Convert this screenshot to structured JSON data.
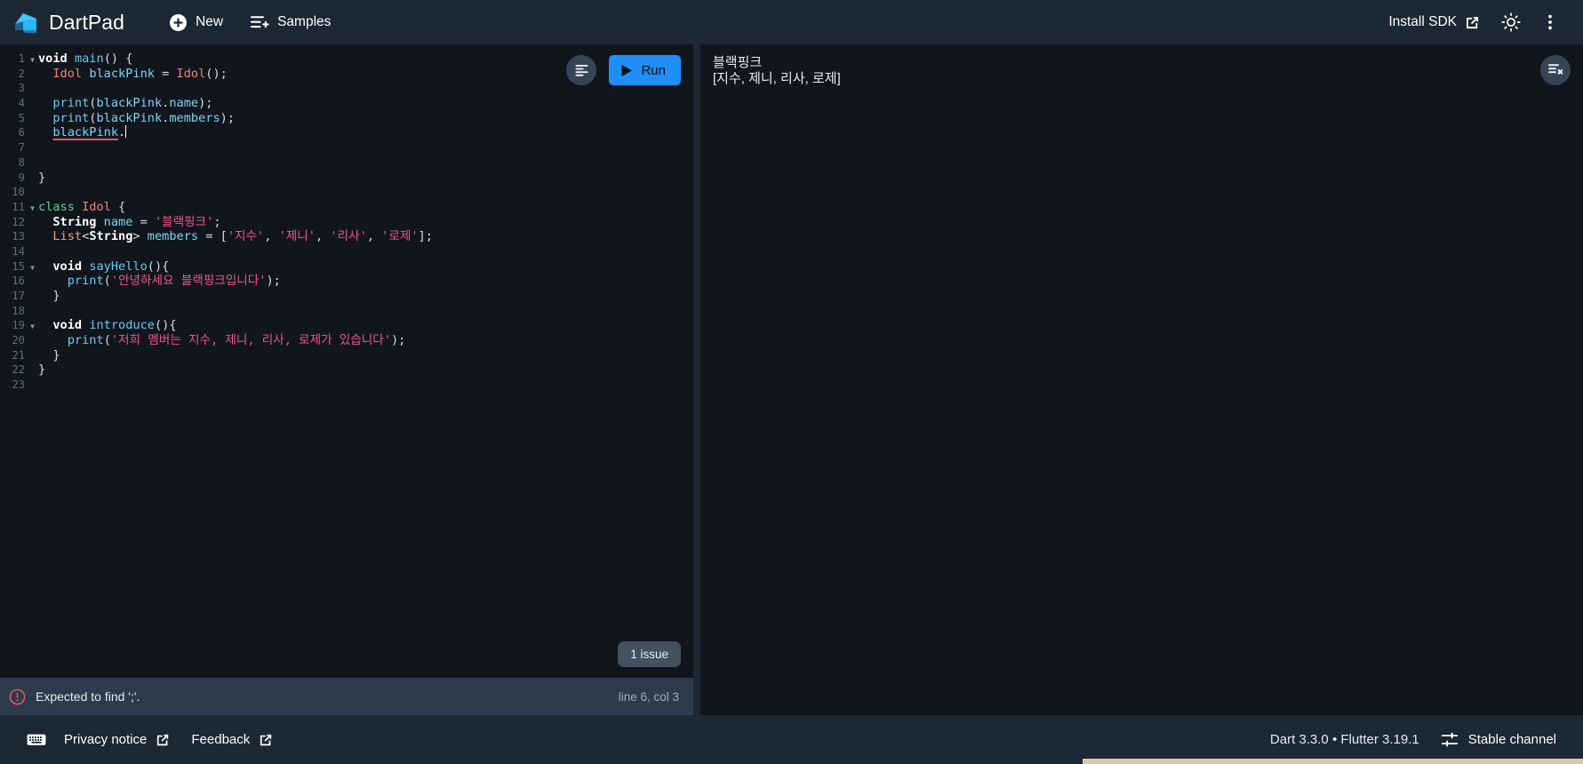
{
  "app": {
    "name": "DartPad"
  },
  "header": {
    "logo_icon": "dart-logo-icon",
    "new_label": "New",
    "new_icon": "plus-circle-icon",
    "samples_label": "Samples",
    "samples_icon": "list-add-icon",
    "install_sdk_label": "Install SDK",
    "install_sdk_icon": "external-link-icon",
    "theme_icon": "brightness-sun-icon",
    "overflow_icon": "more-vert-icon"
  },
  "editor": {
    "format_icon": "format-align-icon",
    "run_label": "Run",
    "run_icon": "play-triangle-icon",
    "issue_pill_label": "1 issue",
    "cursor_line": 6,
    "lines": [
      {
        "n": "1",
        "fold": true,
        "tokens": [
          {
            "t": "void",
            "c": "kwb"
          },
          {
            "t": " ",
            "c": "punct"
          },
          {
            "t": "main",
            "c": "fn"
          },
          {
            "t": "() {",
            "c": "punct"
          }
        ]
      },
      {
        "n": "2",
        "fold": false,
        "tokens": [
          {
            "t": "  ",
            "c": "punct"
          },
          {
            "t": "Idol",
            "c": "typ"
          },
          {
            "t": " ",
            "c": "punct"
          },
          {
            "t": "blackPink",
            "c": "prop"
          },
          {
            "t": " = ",
            "c": "punct"
          },
          {
            "t": "Idol",
            "c": "typ"
          },
          {
            "t": "();",
            "c": "punct"
          }
        ]
      },
      {
        "n": "3",
        "fold": false,
        "tokens": []
      },
      {
        "n": "4",
        "fold": false,
        "tokens": [
          {
            "t": "  ",
            "c": "punct"
          },
          {
            "t": "print",
            "c": "fn"
          },
          {
            "t": "(",
            "c": "punct"
          },
          {
            "t": "blackPink",
            "c": "prop"
          },
          {
            "t": ".",
            "c": "punct"
          },
          {
            "t": "name",
            "c": "prop"
          },
          {
            "t": ");",
            "c": "punct"
          }
        ]
      },
      {
        "n": "5",
        "fold": false,
        "tokens": [
          {
            "t": "  ",
            "c": "punct"
          },
          {
            "t": "print",
            "c": "fn"
          },
          {
            "t": "(",
            "c": "punct"
          },
          {
            "t": "blackPink",
            "c": "prop"
          },
          {
            "t": ".",
            "c": "punct"
          },
          {
            "t": "members",
            "c": "prop"
          },
          {
            "t": ");",
            "c": "punct"
          }
        ]
      },
      {
        "n": "6",
        "fold": false,
        "tokens": [
          {
            "t": "  ",
            "c": "punct"
          },
          {
            "t": "blackPink",
            "c": "prop err-underline"
          },
          {
            "t": ".",
            "c": "punct"
          }
        ],
        "caret": true
      },
      {
        "n": "7",
        "fold": false,
        "tokens": []
      },
      {
        "n": "8",
        "fold": false,
        "tokens": []
      },
      {
        "n": "9",
        "fold": false,
        "tokens": [
          {
            "t": "}",
            "c": "punct"
          }
        ]
      },
      {
        "n": "10",
        "fold": false,
        "tokens": []
      },
      {
        "n": "11",
        "fold": true,
        "tokens": [
          {
            "t": "class",
            "c": "kw"
          },
          {
            "t": " ",
            "c": "punct"
          },
          {
            "t": "Idol",
            "c": "typ"
          },
          {
            "t": " {",
            "c": "punct"
          }
        ]
      },
      {
        "n": "12",
        "fold": false,
        "tokens": [
          {
            "t": "  ",
            "c": "punct"
          },
          {
            "t": "String",
            "c": "kwb"
          },
          {
            "t": " ",
            "c": "punct"
          },
          {
            "t": "name",
            "c": "prop"
          },
          {
            "t": " = ",
            "c": "punct"
          },
          {
            "t": "'블랙핑크'",
            "c": "str"
          },
          {
            "t": ";",
            "c": "punct"
          }
        ]
      },
      {
        "n": "13",
        "fold": false,
        "tokens": [
          {
            "t": "  ",
            "c": "punct"
          },
          {
            "t": "List",
            "c": "typl"
          },
          {
            "t": "<",
            "c": "punct"
          },
          {
            "t": "String",
            "c": "kwb"
          },
          {
            "t": "> ",
            "c": "punct"
          },
          {
            "t": "members",
            "c": "prop"
          },
          {
            "t": " = [",
            "c": "punct"
          },
          {
            "t": "'지수'",
            "c": "str"
          },
          {
            "t": ", ",
            "c": "punct"
          },
          {
            "t": "'제니'",
            "c": "str"
          },
          {
            "t": ", ",
            "c": "punct"
          },
          {
            "t": "'리사'",
            "c": "str"
          },
          {
            "t": ", ",
            "c": "punct"
          },
          {
            "t": "'로제'",
            "c": "str"
          },
          {
            "t": "];",
            "c": "punct"
          }
        ]
      },
      {
        "n": "14",
        "fold": false,
        "tokens": []
      },
      {
        "n": "15",
        "fold": true,
        "tokens": [
          {
            "t": "  ",
            "c": "punct"
          },
          {
            "t": "void",
            "c": "kwb"
          },
          {
            "t": " ",
            "c": "punct"
          },
          {
            "t": "sayHello",
            "c": "fn"
          },
          {
            "t": "(){",
            "c": "punct"
          }
        ]
      },
      {
        "n": "16",
        "fold": false,
        "tokens": [
          {
            "t": "    ",
            "c": "punct"
          },
          {
            "t": "print",
            "c": "fn"
          },
          {
            "t": "(",
            "c": "punct"
          },
          {
            "t": "'안녕하세요 블랙핑크입니다'",
            "c": "str"
          },
          {
            "t": ");",
            "c": "punct"
          }
        ]
      },
      {
        "n": "17",
        "fold": false,
        "tokens": [
          {
            "t": "  }",
            "c": "punct"
          }
        ]
      },
      {
        "n": "18",
        "fold": false,
        "tokens": []
      },
      {
        "n": "19",
        "fold": true,
        "tokens": [
          {
            "t": "  ",
            "c": "punct"
          },
          {
            "t": "void",
            "c": "kwb"
          },
          {
            "t": " ",
            "c": "punct"
          },
          {
            "t": "introduce",
            "c": "fn"
          },
          {
            "t": "(){",
            "c": "punct"
          }
        ]
      },
      {
        "n": "20",
        "fold": false,
        "tokens": [
          {
            "t": "    ",
            "c": "punct"
          },
          {
            "t": "print",
            "c": "fn"
          },
          {
            "t": "(",
            "c": "punct"
          },
          {
            "t": "'저희 멤버는 지수, 제니, 리사, 로제가 있습니다'",
            "c": "str"
          },
          {
            "t": ");",
            "c": "punct"
          }
        ]
      },
      {
        "n": "21",
        "fold": false,
        "tokens": [
          {
            "t": "  }",
            "c": "punct"
          }
        ]
      },
      {
        "n": "22",
        "fold": false,
        "tokens": [
          {
            "t": "}",
            "c": "punct"
          }
        ]
      },
      {
        "n": "23",
        "fold": false,
        "tokens": []
      }
    ]
  },
  "problem": {
    "icon": "error-circle-icon",
    "message": "Expected to find ';'.",
    "location": "line 6, col 3",
    "severity_color": "#e8585d"
  },
  "console": {
    "clear_icon": "clear-console-icon",
    "output": "블랙핑크\n[지수, 제니, 리사, 로제]"
  },
  "footer": {
    "keyboard_icon": "keyboard-icon",
    "privacy_label": "Privacy notice",
    "privacy_icon": "external-link-icon",
    "feedback_label": "Feedback",
    "feedback_icon": "external-link-icon",
    "version_label": "Dart 3.3.0 • Flutter 3.19.1",
    "channel_icon": "tune-icon",
    "channel_label": "Stable channel"
  },
  "colors": {
    "accent": "#1f8ff7",
    "chrome": "#1c2834",
    "panel": "#11161d",
    "problem_bar": "#2d3b4c"
  }
}
